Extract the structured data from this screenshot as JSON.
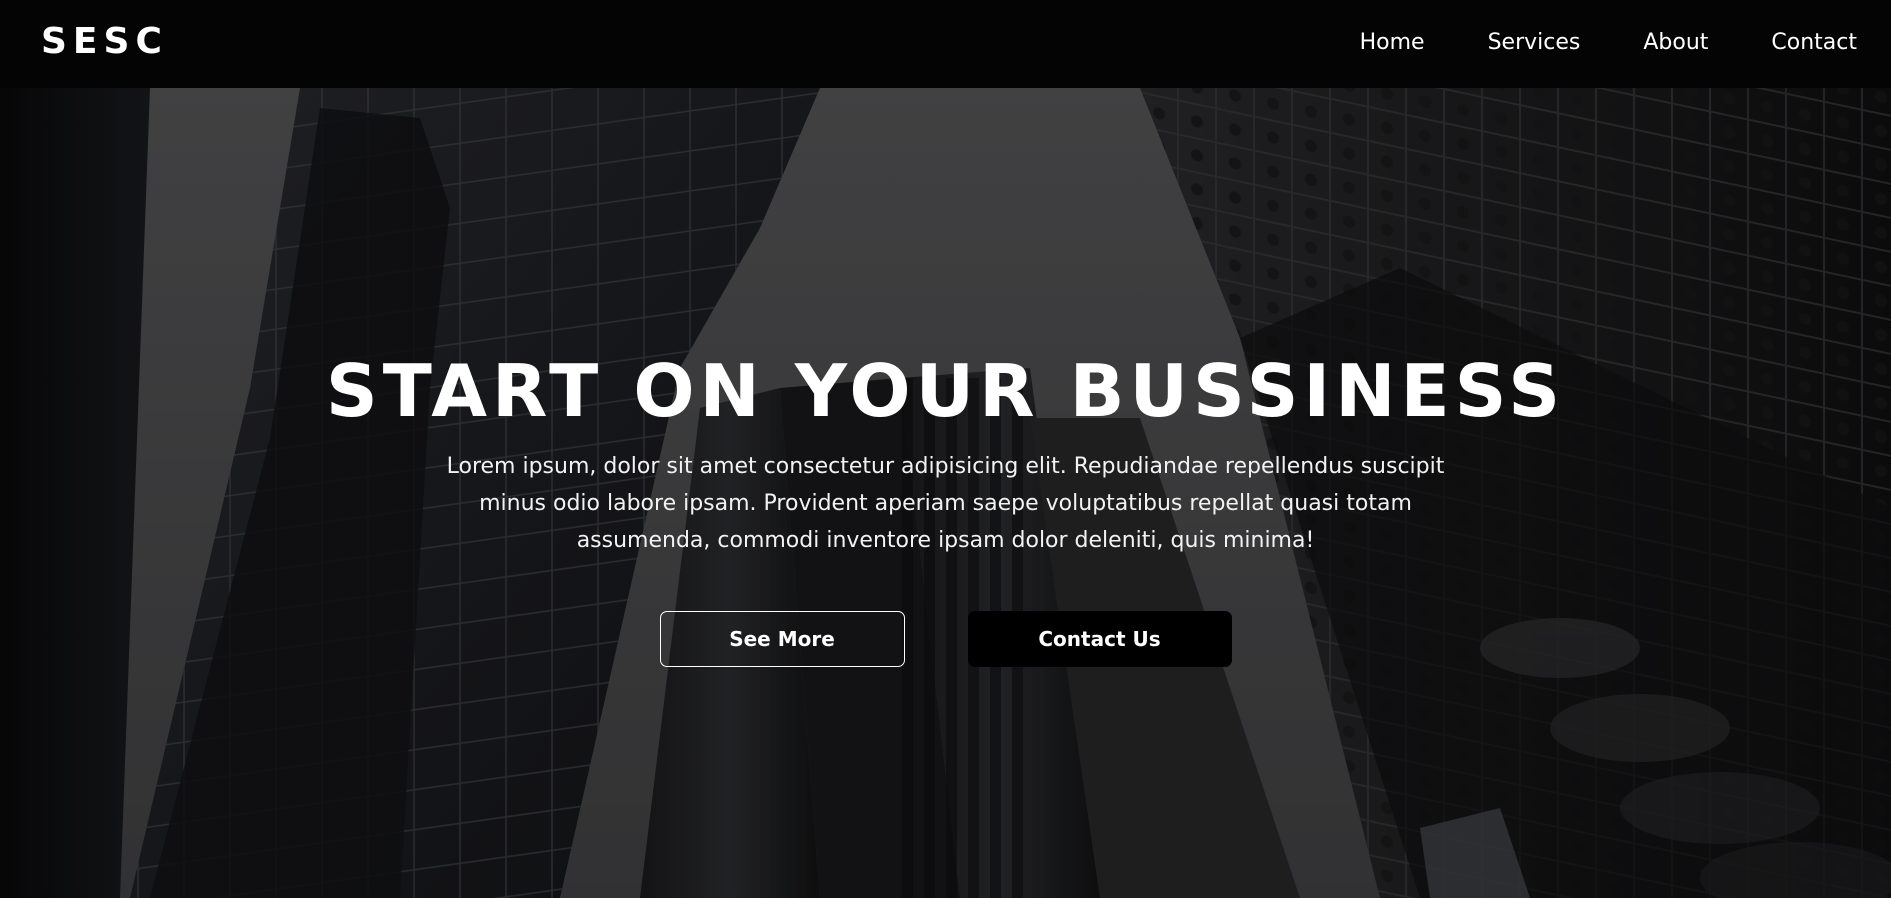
{
  "navbar": {
    "logo": "SESC",
    "links": [
      {
        "label": "Home"
      },
      {
        "label": "Services"
      },
      {
        "label": "About"
      },
      {
        "label": "Contact"
      }
    ]
  },
  "hero": {
    "title": "START ON YOUR BUSSINESS",
    "description": "Lorem ipsum, dolor sit amet consectetur adipisicing elit. Repudiandae repellendus suscipit minus odio labore ipsam. Provident aperiam saepe voluptatibus repellat quasi totam assumenda, commodi inventore ipsam dolor deleniti, quis minima!",
    "buttons": {
      "see_more": "See More",
      "contact_us": "Contact Us"
    },
    "background_image": "skyscrapers-looking-up"
  },
  "colors": {
    "navbar_bg": "#040404",
    "text": "#ffffff",
    "button_solid_bg": "#000000"
  }
}
